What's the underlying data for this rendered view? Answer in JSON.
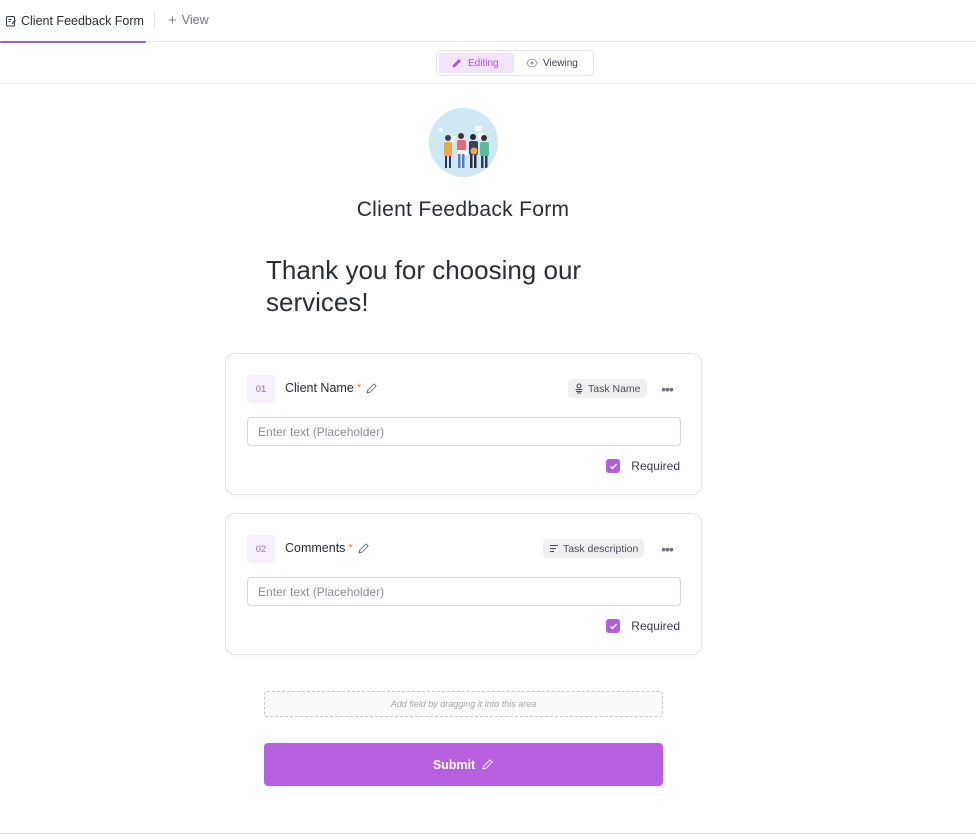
{
  "tabs": {
    "active": {
      "label": "Client Feedback Form",
      "icon": "form-icon"
    },
    "add_view": {
      "label": "View",
      "icon": "plus-icon"
    }
  },
  "mode_toggle": {
    "editing": {
      "label": "Editing",
      "icon": "pencil-icon",
      "active": true
    },
    "viewing": {
      "label": "Viewing",
      "icon": "eye-icon",
      "active": false
    }
  },
  "form": {
    "cover_image": "people-illustration",
    "title": "Client Feedback Form",
    "heading": "Thank you for choosing our services!",
    "fields": [
      {
        "number": "01",
        "label": "Client Name",
        "required_marker": "*",
        "mapping": "Task Name",
        "mapping_icon": "task-name-icon",
        "placeholder": "Enter text (Placeholder)",
        "value": "",
        "required_label": "Required",
        "required": true
      },
      {
        "number": "02",
        "label": "Comments",
        "required_marker": "*",
        "mapping": "Task description",
        "mapping_icon": "text-lines-icon",
        "placeholder": "Enter text (Placeholder)",
        "value": "",
        "required_label": "Required",
        "required": true
      }
    ],
    "dropzone_text": "Add field by dragging it into this area",
    "submit_label": "Submit"
  },
  "colors": {
    "accent": "#b660df",
    "accent_light": "#f3e3fb",
    "required_star": "#e5734b"
  }
}
